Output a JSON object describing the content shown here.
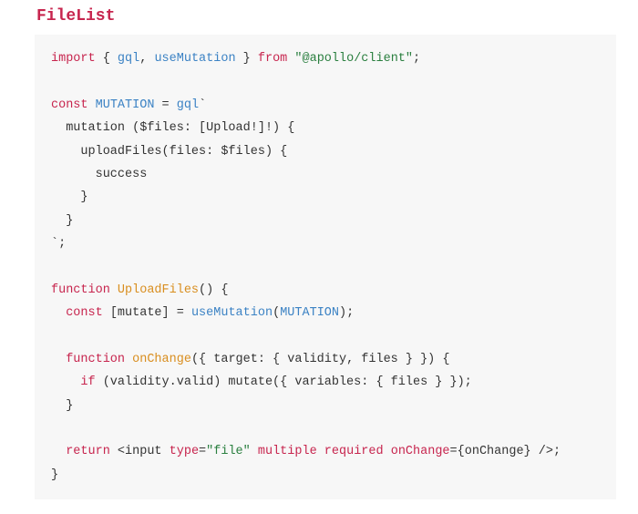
{
  "title": "FileList",
  "code": {
    "l1_import": "import",
    "l1_braces_open": " { ",
    "l1_gql": "gql",
    "l1_comma": ", ",
    "l1_useMutation": "useMutation",
    "l1_braces_close": " } ",
    "l1_from": "from",
    "l1_space": " ",
    "l1_str": "\"@apollo/client\"",
    "l1_semi": ";",
    "l3_const": "const",
    "l3_sp": " ",
    "l3_MUTATION": "MUTATION",
    "l3_eq": " = ",
    "l3_gql": "gql",
    "l3_tick": "`",
    "l4": "  mutation ($files: [Upload!]!) {",
    "l5": "    uploadFiles(files: $files) {",
    "l6": "      success",
    "l7": "    }",
    "l8": "  }",
    "l9": "`;",
    "l11_function": "function",
    "l11_sp": " ",
    "l11_name": "UploadFiles",
    "l11_rest": "() {",
    "l12_indent": "  ",
    "l12_const": "const",
    "l12_sp": " ",
    "l12_destruct": "[mutate] = ",
    "l12_useMutation": "useMutation",
    "l12_paren_open": "(",
    "l12_mutarg": "MUTATION",
    "l12_paren_close": ");",
    "l14_indent": "  ",
    "l14_function": "function",
    "l14_sp": " ",
    "l14_name": "onChange",
    "l14_rest": "({ target: { validity, files } }) {",
    "l15_indent": "    ",
    "l15_if": "if",
    "l15_rest": " (validity.valid) mutate({ variables: { files } });",
    "l16": "  }",
    "l18_indent": "  ",
    "l18_return": "return",
    "l18_sp": " ",
    "l18_open": "<input ",
    "l18_attr_type": "type",
    "l18_eq": "=",
    "l18_val_file": "\"file\"",
    "l18_sp2": " ",
    "l18_attr_multiple": "multiple",
    "l18_sp3": " ",
    "l18_attr_required": "required",
    "l18_sp4": " ",
    "l18_attr_onChange": "onChange",
    "l18_eq2": "=",
    "l18_val_onChange": "{onChange}",
    "l18_close": " />;",
    "l19": "}"
  }
}
